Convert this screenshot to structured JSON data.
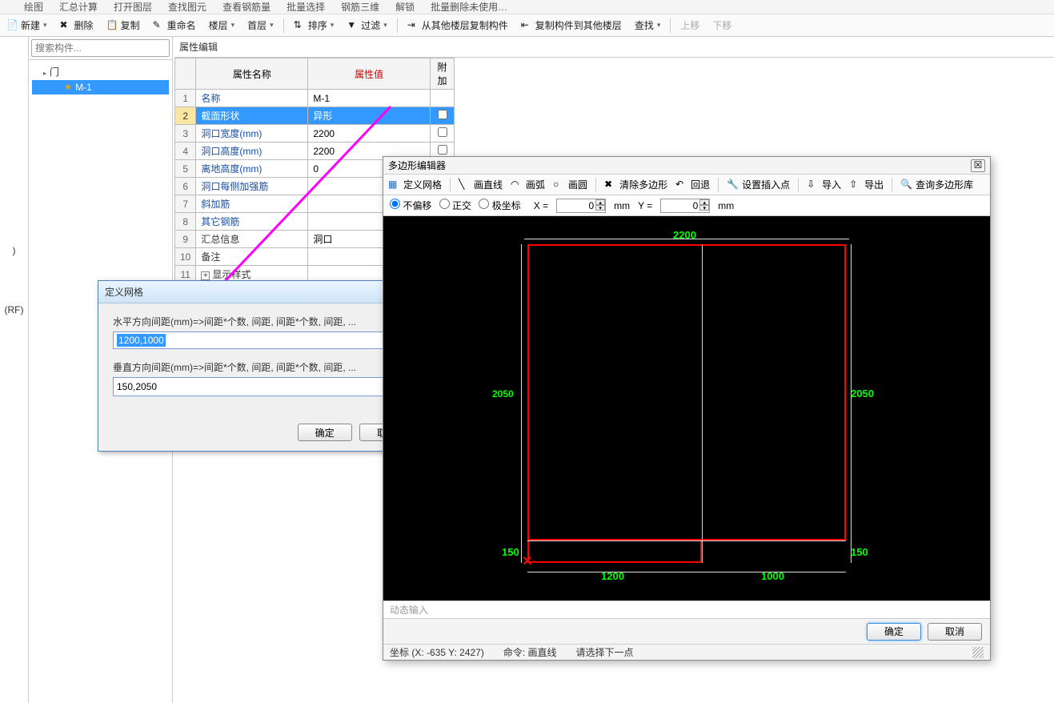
{
  "ribbon_top": {
    "items": [
      "绘图",
      "汇总计算",
      "打开图层",
      "查找图元",
      "查看钢筋量",
      "批量选择",
      "钢筋三维",
      "解锁",
      "批量删除未使用…"
    ]
  },
  "toolbar2": {
    "new": "新建",
    "delete": "删除",
    "copy": "复制",
    "rename": "重命名",
    "floors": "楼层",
    "first_floor": "首层",
    "sort": "排序",
    "filter": "过滤",
    "copy_from_other": "从其他楼层复制构件",
    "copy_to_other": "复制构件到其他楼层",
    "find": "查找",
    "move_up": "上移",
    "move_down": "下移"
  },
  "search_placeholder": "搜索构件...",
  "tree": {
    "root": "门",
    "child": "M-1"
  },
  "property_panel": {
    "title": "属性编辑",
    "headers": {
      "name": "属性名称",
      "value": "属性值",
      "extra": "附加"
    },
    "rows": [
      {
        "n": "1",
        "name": "名称",
        "value": "M-1",
        "chk": false
      },
      {
        "n": "2",
        "name": "截面形状",
        "value": "异形",
        "chk": true,
        "sel": true
      },
      {
        "n": "3",
        "name": "洞口宽度(mm)",
        "value": "2200",
        "chk": true
      },
      {
        "n": "4",
        "name": "洞口高度(mm)",
        "value": "2200",
        "chk": true
      },
      {
        "n": "5",
        "name": "离地高度(mm)",
        "value": "0",
        "chk": true
      },
      {
        "n": "6",
        "name": "洞口每侧加强筋",
        "value": "",
        "chk": true
      },
      {
        "n": "7",
        "name": "斜加筋",
        "value": "",
        "chk": true
      },
      {
        "n": "8",
        "name": "其它钢筋",
        "value": "",
        "chk": false
      },
      {
        "n": "9",
        "name": "汇总信息",
        "value": "洞口",
        "chk": true,
        "plain": true
      },
      {
        "n": "10",
        "name": "备注",
        "value": "",
        "chk": true,
        "plain": true
      },
      {
        "n": "11",
        "name": "显示样式",
        "value": "",
        "chk": false,
        "plain": true,
        "expand": true
      }
    ]
  },
  "grid_dialog": {
    "title": "定义网格",
    "h_label": "水平方向间距(mm)=>间距*个数, 间距, 间距*个数, 间距, ...",
    "h_value": "1200,1000",
    "v_label": "垂直方向间距(mm)=>间距*个数, 间距, 间距*个数, 间距, ...",
    "v_value": "150,2050",
    "ok": "确定",
    "cancel": "取消"
  },
  "poly_editor": {
    "title": "多边形编辑器",
    "toolbar": {
      "define_grid": "定义网格",
      "line": "画直线",
      "arc": "画弧",
      "circle": "画圆",
      "clear": "清除多边形",
      "undo": "回退",
      "set_insert": "设置插入点",
      "import": "导入",
      "export": "导出",
      "query_lib": "查询多边形库"
    },
    "coord": {
      "opt1": "不偏移",
      "opt2": "正交",
      "opt3": "极坐标",
      "xlabel": "X =",
      "xval": "0",
      "xunit": "mm",
      "ylabel": "Y =",
      "yval": "0",
      "yunit": "mm"
    },
    "dims": {
      "top": "2200",
      "left": "2050",
      "right": "2050",
      "left_small": "150",
      "right_small": "150",
      "bottom_left": "1200",
      "bottom_right": "1000"
    },
    "dyn_input": "动态输入",
    "ok": "确定",
    "cancel": "取消",
    "status": {
      "coord": "坐标 (X: -635 Y: 2427)",
      "cmd": "命令: 画直线",
      "hint": "请选择下一点"
    }
  },
  "left_thin": {
    "label1": ")",
    "label2": "(RF)"
  }
}
